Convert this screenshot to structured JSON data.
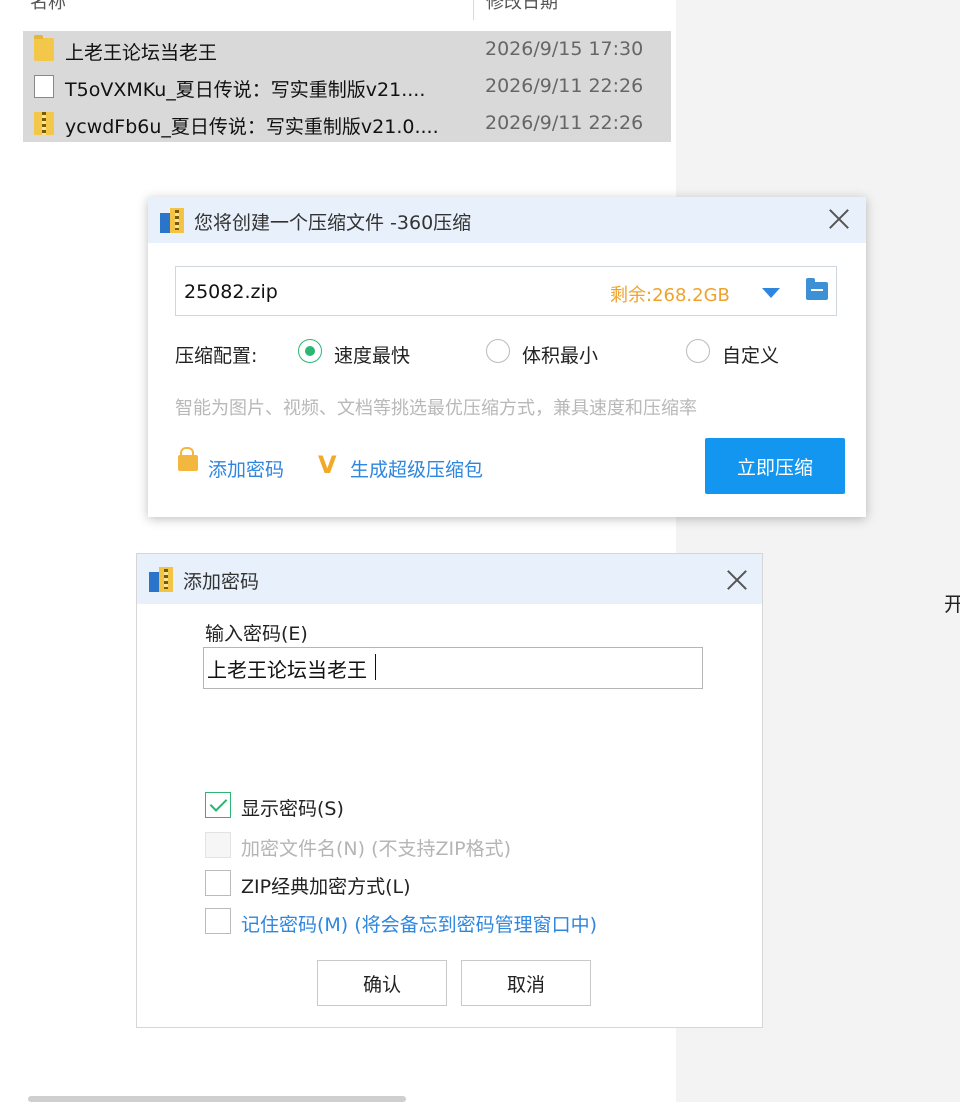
{
  "explorer": {
    "col_name": "名称",
    "col_date": "修改日期",
    "files": [
      {
        "icon": "folder-icon",
        "name": "上老王论坛当老王",
        "date": "2026/9/15 17:30"
      },
      {
        "icon": "document-icon",
        "name": "T5oVXMKu_夏日传说：写实重制版v21....",
        "date": "2026/9/11 22:26"
      },
      {
        "icon": "zip-archive-icon",
        "name": "ycwdFb6u_夏日传说：写实重制版v21.0....",
        "date": "2026/9/11 22:26"
      }
    ],
    "edge_char": "开"
  },
  "compress_dialog": {
    "title": "您将创建一个压缩文件 -360压缩",
    "filename": "25082.zip",
    "free_space": "剩余:268.2GB",
    "config_label": "压缩配置:",
    "options": [
      {
        "label": "速度最快",
        "selected": true
      },
      {
        "label": "体积最小",
        "selected": false
      },
      {
        "label": "自定义",
        "selected": false
      }
    ],
    "hint": "智能为图片、视频、文档等挑选最优压缩方式，兼具速度和压缩率",
    "add_password": "添加密码",
    "super_pack_icon": "V",
    "super_pack": "生成超级压缩包",
    "compress_now": "立即压缩"
  },
  "password_dialog": {
    "title": "添加密码",
    "input_label": "输入密码(E)",
    "password_value": "上老王论坛当老王",
    "checkboxes": [
      {
        "label": "显示密码(S)",
        "checked": true,
        "disabled": false
      },
      {
        "label": "加密文件名(N) (不支持ZIP格式)",
        "checked": false,
        "disabled": true
      },
      {
        "label": "ZIP经典加密方式(L)",
        "checked": false,
        "disabled": false
      },
      {
        "label": "记住密码(M) (将会备忘到密码管理窗口中)",
        "checked": false,
        "disabled": false
      }
    ],
    "ok": "确认",
    "cancel": "取消"
  },
  "colors": {
    "accent_blue": "#1296f0",
    "link_blue": "#2e86de",
    "radio_green": "#2bb673",
    "free_space_orange": "#f0a22b"
  }
}
